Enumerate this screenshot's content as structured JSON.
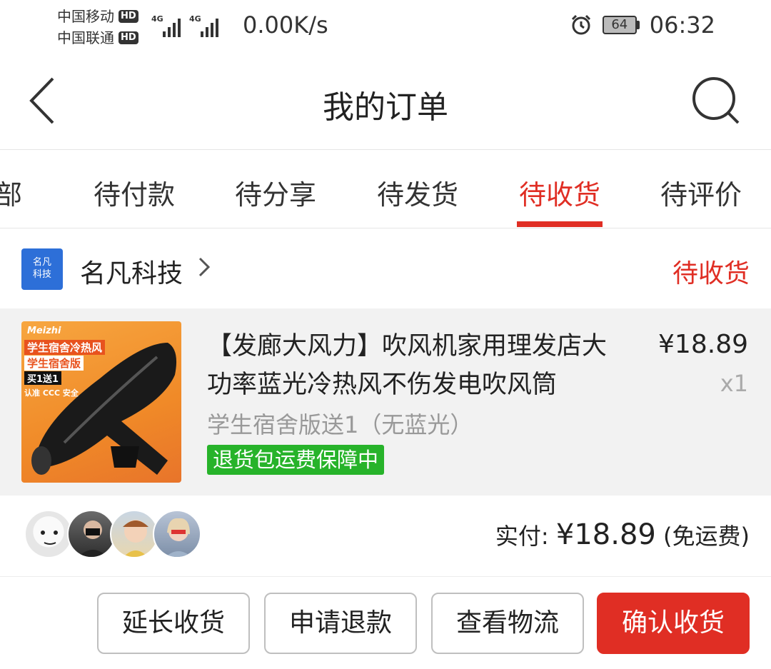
{
  "status_bar": {
    "carrier1": "中国移动",
    "carrier2": "中国联通",
    "hd": "HD",
    "signal_tag": "4G",
    "net_speed": "0.00K/s",
    "battery": "64",
    "time": "06:32",
    "icons": [
      "alarm-icon",
      "battery-icon",
      "signal-icon"
    ]
  },
  "header": {
    "title": "我的订单",
    "icons": [
      "back-icon",
      "search-icon"
    ]
  },
  "tabs": {
    "items": [
      "部",
      "待付款",
      "待分享",
      "待发货",
      "待收货",
      "待评价"
    ],
    "active": "待收货"
  },
  "store": {
    "logo_line1": "名凡",
    "logo_line2": "科技",
    "name": "名凡科技",
    "status": "待收货"
  },
  "product": {
    "title": "【发廊大风力】吹风机家用理发店大功率蓝光冷热风不伤发电吹风筒",
    "spec": "学生宿舍版送1（无蓝光）",
    "badge": "退货包运费保障中",
    "price": "¥18.89",
    "quantity": "x1",
    "thumb": {
      "brand": "Meizhi",
      "line1": "学生宿舍冷热风",
      "line2": "学生宿舍版",
      "line3": "买1送1",
      "line4": "认准 CCC 安全"
    }
  },
  "payment": {
    "label": "实付: ",
    "amount": "¥18.89",
    "shipping": " (免运费)"
  },
  "actions": {
    "extend": "延长收货",
    "refund": "申请退款",
    "logistics": "查看物流",
    "confirm": "确认收货"
  },
  "colors": {
    "accent": "#e02e24",
    "badge_green": "#27b32a",
    "store_logo_blue": "#2d6fd8"
  }
}
